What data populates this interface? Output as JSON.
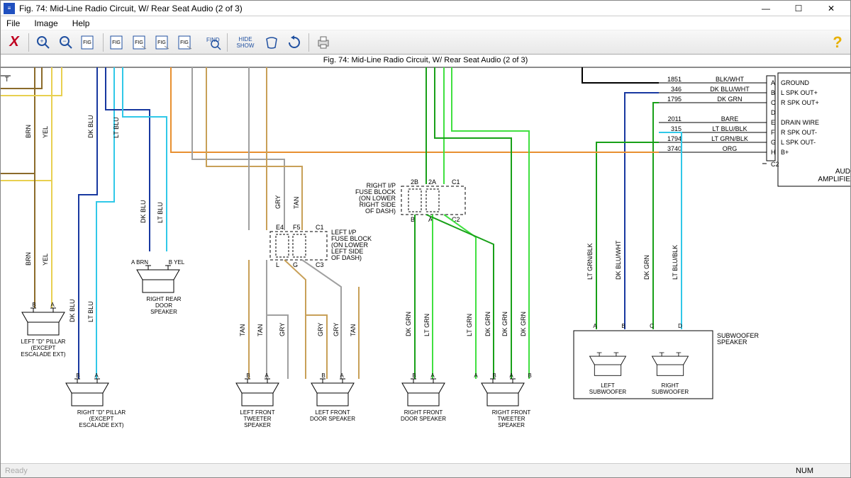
{
  "title": "Fig. 74: Mid-Line Radio Circuit, W/ Rear Seat Audio (2 of 3)",
  "menu": {
    "file": "File",
    "image": "Image",
    "help": "Help"
  },
  "toolbar": {
    "close": "X",
    "zoomIn": "+",
    "zoomOut": "-",
    "fig1": "FIG",
    "fig2": "FIG",
    "fig3": "FIG",
    "fig4": "FIG",
    "fig5": "FIG",
    "find": "FIND",
    "hideshow": "HIDE\nSHOW",
    "refresh": "↻",
    "print": "🖨",
    "helpQ": "?"
  },
  "docTitle": "Fig. 74: Mid-Line Radio Circuit, W/ Rear Seat Audio (2 of 3)",
  "status": {
    "left": "Ready",
    "num": "NUM"
  },
  "winControls": {
    "min": "—",
    "max": "☐",
    "close": "✕"
  },
  "colors": {
    "brn": "#8b6b2a",
    "yel": "#e8d050",
    "dkblu": "#1838a0",
    "ltblu": "#30c8e8",
    "gry": "#a0a0a0",
    "tan": "#c8a058",
    "dkgrn": "#18a018",
    "ltgrn": "#40e040",
    "org": "#e89030",
    "blk": "#000000"
  },
  "pins": [
    {
      "num": "1851",
      "color": "BLK/WHT",
      "pin": "A",
      "sig": "GROUND"
    },
    {
      "num": "346",
      "color": "DK BLU/WHT",
      "pin": "B",
      "sig": "L SPK OUT+"
    },
    {
      "num": "1795",
      "color": "DK GRN",
      "pin": "C",
      "sig": "R SPK OUT+"
    },
    {
      "num": "",
      "color": "",
      "pin": "D",
      "sig": ""
    },
    {
      "num": "2011",
      "color": "BARE",
      "pin": "E",
      "sig": "DRAIN WIRE"
    },
    {
      "num": "315",
      "color": "LT BLU/BLK",
      "pin": "F",
      "sig": "R SPK OUT-"
    },
    {
      "num": "1794",
      "color": "LT GRN/BLK",
      "pin": "G",
      "sig": "L SPK OUT-"
    },
    {
      "num": "3740",
      "color": "ORG",
      "pin": "H",
      "sig": "B+"
    }
  ],
  "modLabel": "AUD\nAMPLIFIE",
  "c2": "C2",
  "speakers": {
    "ldp": "LEFT \"D\" PILLAR\n(EXCEPT\nESCALADE EXT)",
    "rdp": "RIGHT \"D\" PILLAR\n(EXCEPT\nESCALADE EXT)",
    "rrds": "RIGHT REAR\nDOOR\nSPEAKER",
    "lfts": "LEFT FRONT\nTWEETER\nSPEAKER",
    "lfds": "LEFT FRONT\nDOOR SPEAKER",
    "rfds": "RIGHT FRONT\nDOOR SPEAKER",
    "rfts": "RIGHT FRONT\nTWEETER\nSPEAKER",
    "lsub": "LEFT\nSUBWOOFER",
    "rsub": "RIGHT\nSUBWOOFER",
    "subsp": "SUBWOOFER\nSPEAKER"
  },
  "wireLabels": {
    "brn": "BRN",
    "yel": "YEL",
    "dkblu": "DK BLU",
    "ltblu": "LT BLU",
    "gry": "GRY",
    "tan": "TAN",
    "dkgrn": "DK GRN",
    "ltgrn": "LT GRN",
    "ltgrnblk": "LT GRN/BLK",
    "dkbluwht": "DK BLU/WHT",
    "ltblublk": "LT BLU/BLK"
  },
  "fuseBlocks": {
    "right": "RIGHT I/P\nFUSE BLOCK\n(ON LOWER\nRIGHT SIDE\nOF DASH)",
    "left": "LEFT I/P\nFUSE BLOCK\n(ON LOWER\nLEFT SIDE\nOF DASH)",
    "rPins": {
      "t1": "2B",
      "t2": "2A",
      "t3": "C1",
      "b1": "B",
      "b2": "A",
      "b3": "C2"
    },
    "lPins": {
      "t1": "E4",
      "t2": "F5",
      "t3": "C1",
      "b1": "L",
      "b2": "G",
      "b3": "C3"
    }
  },
  "pinLetters": {
    "a": "A",
    "b": "B",
    "c": "C",
    "d": "D"
  },
  "connLetter": "T"
}
